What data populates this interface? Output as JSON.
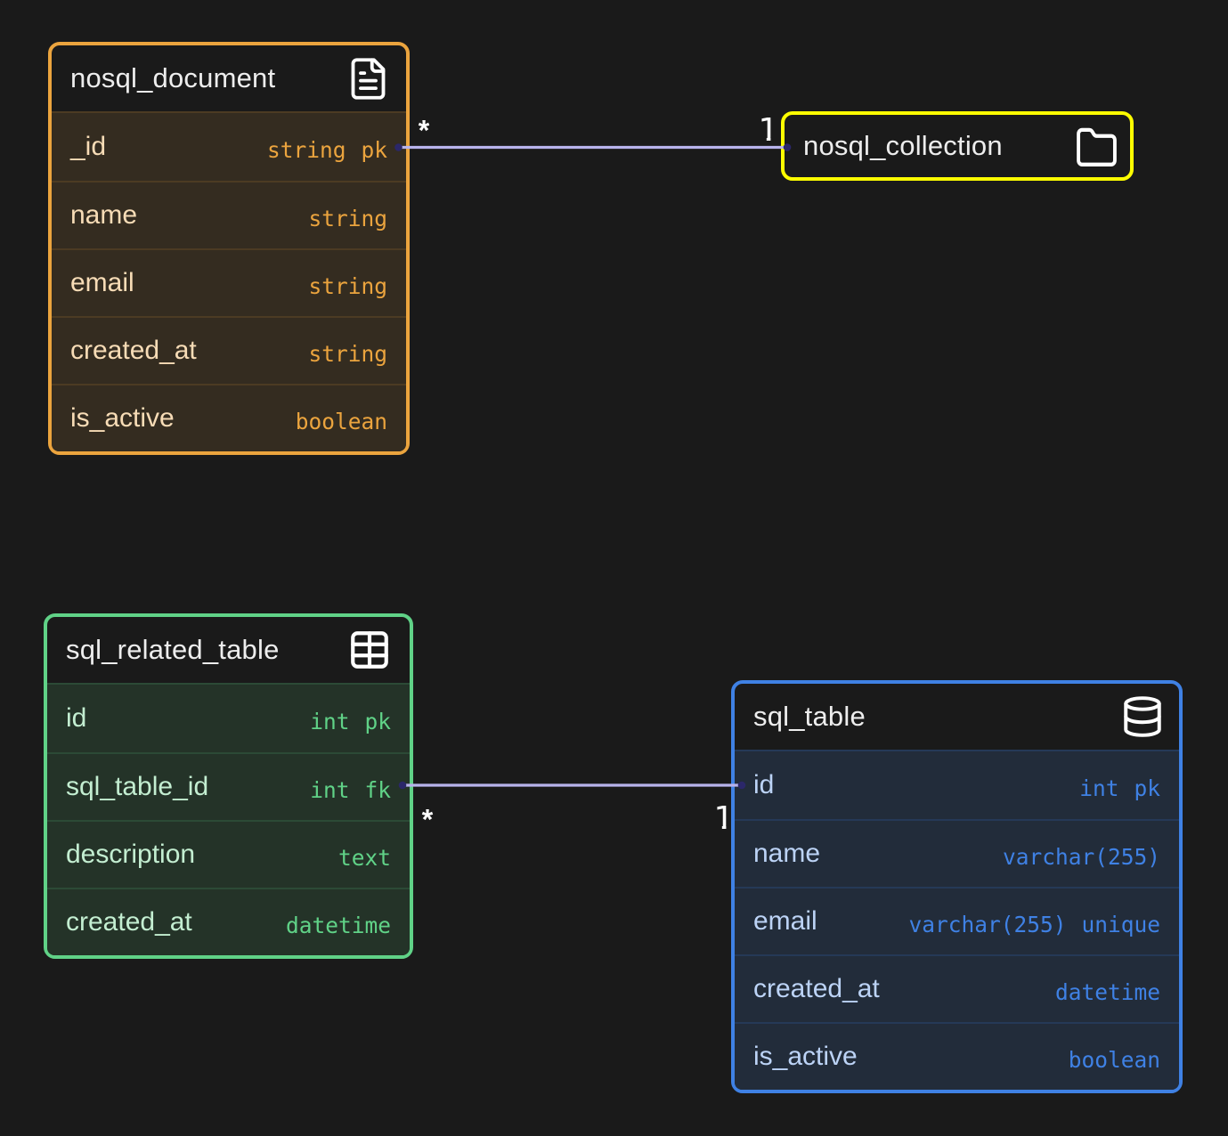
{
  "canvas": {
    "background": "#1a1a1a"
  },
  "tables": [
    {
      "name": "nosql_document",
      "icon": "file-text-icon",
      "accent": "#eba43e",
      "fields": [
        {
          "name": "_id",
          "type": "string",
          "constraint": "pk"
        },
        {
          "name": "name",
          "type": "string",
          "constraint": ""
        },
        {
          "name": "email",
          "type": "string",
          "constraint": ""
        },
        {
          "name": "created_at",
          "type": "string",
          "constraint": ""
        },
        {
          "name": "is_active",
          "type": "boolean",
          "constraint": ""
        }
      ]
    },
    {
      "name": "nosql_collection",
      "icon": "folder-icon",
      "accent": "#fdfd00",
      "fields": []
    },
    {
      "name": "sql_related_table",
      "icon": "table-grid-icon",
      "accent": "#60d287",
      "fields": [
        {
          "name": "id",
          "type": "int",
          "constraint": "pk"
        },
        {
          "name": "sql_table_id",
          "type": "int",
          "constraint": "fk"
        },
        {
          "name": "description",
          "type": "text",
          "constraint": ""
        },
        {
          "name": "created_at",
          "type": "datetime",
          "constraint": ""
        }
      ]
    },
    {
      "name": "sql_table",
      "icon": "database-icon",
      "accent": "#3f81e4",
      "fields": [
        {
          "name": "id",
          "type": "int",
          "constraint": "pk"
        },
        {
          "name": "name",
          "type": "varchar(255)",
          "constraint": ""
        },
        {
          "name": "email",
          "type": "varchar(255)",
          "constraint": "unique"
        },
        {
          "name": "created_at",
          "type": "datetime",
          "constraint": ""
        },
        {
          "name": "is_active",
          "type": "boolean",
          "constraint": ""
        }
      ]
    }
  ],
  "relationships": [
    {
      "from_table": "nosql_document",
      "from_field": "_id",
      "to_table": "nosql_collection",
      "from_cardinality": "*",
      "to_cardinality": "1"
    },
    {
      "from_table": "sql_related_table",
      "from_field": "sql_table_id",
      "to_table": "sql_table",
      "to_field": "id",
      "from_cardinality": "*",
      "to_cardinality": "1"
    }
  ],
  "colors": {
    "relationship_line": "#b8b3ec",
    "relationship_dot": "#2b2769"
  }
}
